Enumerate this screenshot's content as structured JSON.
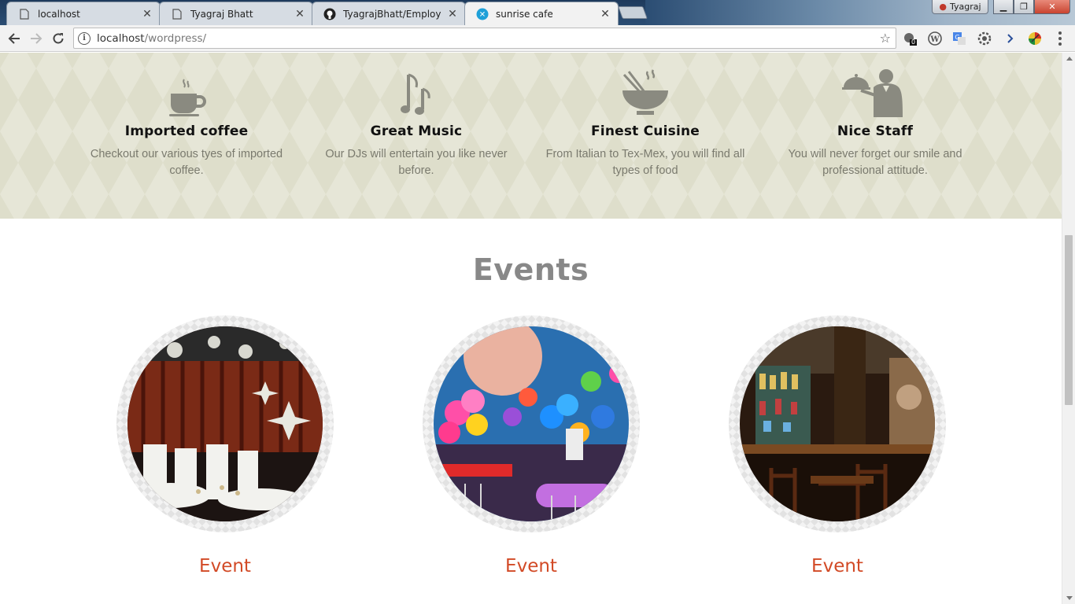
{
  "browser": {
    "tabs": [
      {
        "title": "localhost",
        "icon": "page-icon",
        "active": false
      },
      {
        "title": "Tyagraj Bhatt",
        "icon": "page-icon",
        "active": false
      },
      {
        "title": "TyagrajBhatt/Employee-t",
        "icon": "github-icon",
        "active": false
      },
      {
        "title": "sunrise cafe",
        "icon": "wordpress-icon",
        "active": true
      }
    ],
    "profile_name": "Tyagraj",
    "url_host": "localhost",
    "url_path": "/wordpress/",
    "extension_badge": "0"
  },
  "features": [
    {
      "title": "Imported coffee",
      "description": "Checkout our various tyes of imported coffee.",
      "icon": "coffee-cup-icon"
    },
    {
      "title": "Great Music",
      "description": "Our DJs will entertain you like never before.",
      "icon": "music-note-icon"
    },
    {
      "title": "Finest Cuisine",
      "description": "From Italian to Tex-Mex, you will find all types of food",
      "icon": "food-bowl-icon"
    },
    {
      "title": "Nice Staff",
      "description": "You will never forget our smile and professional attitude.",
      "icon": "waiter-icon"
    }
  ],
  "events": {
    "heading": "Events",
    "items": [
      {
        "label": "Event",
        "image": "banquet-hall-photo"
      },
      {
        "label": "Event",
        "image": "balloon-party-photo"
      },
      {
        "label": "Event",
        "image": "restaurant-bar-photo"
      }
    ]
  },
  "colors": {
    "feature_bg": "#e6e6d7",
    "event_label": "#d24a26",
    "heading_gray": "#888888"
  }
}
